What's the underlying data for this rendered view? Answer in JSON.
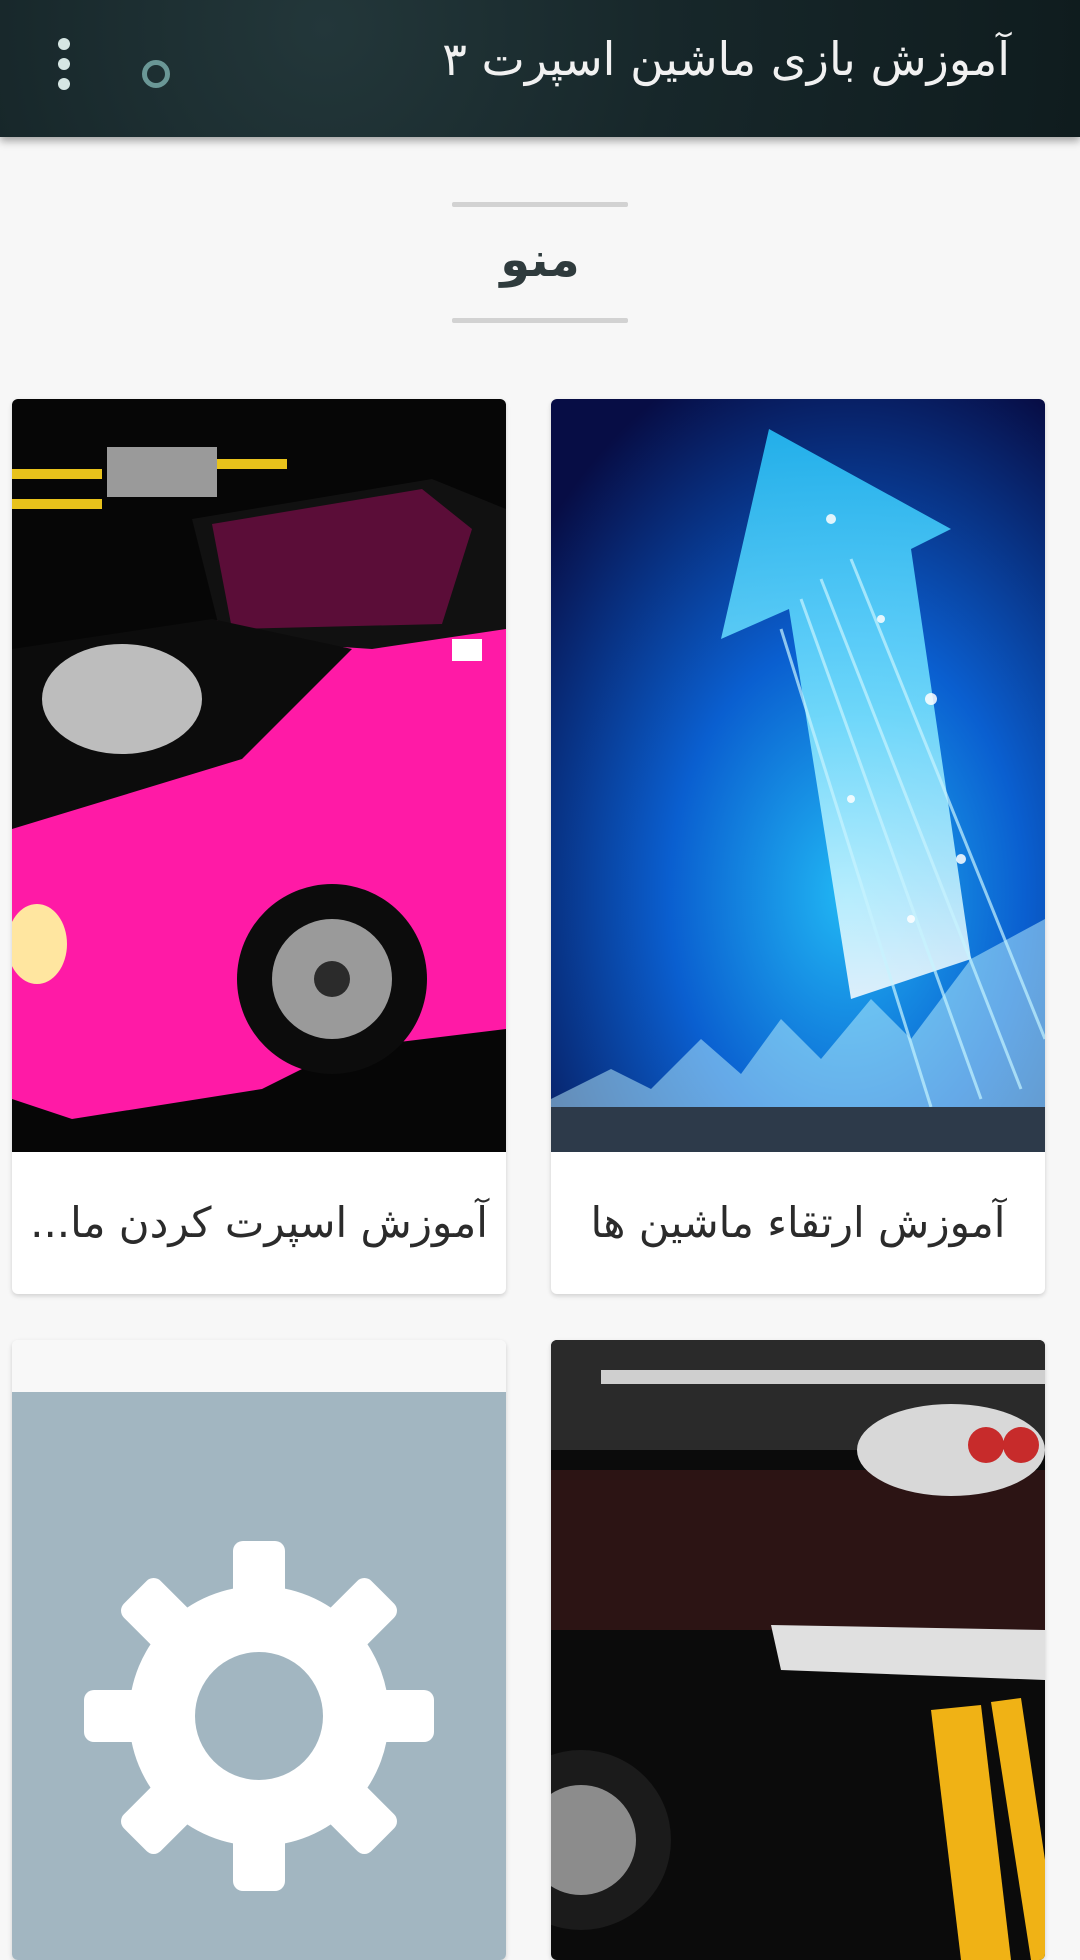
{
  "app_bar": {
    "title": "آموزش بازی ماشین اسپرت ۳",
    "menu_icon": "more-vert-icon",
    "circle_icon": "circle-outline-icon",
    "background_color": "#17272a"
  },
  "section": {
    "title": "منو"
  },
  "cards": [
    {
      "label": "آموزش ارتقاء ماشین ها",
      "image": "blue-upgrade-arrow-image"
    },
    {
      "label": "آموزش اسپرت کردن ما...",
      "image": "pink-sport-car-image"
    },
    {
      "label": "",
      "image": "black-muscle-car-image"
    },
    {
      "label": "",
      "image": "settings-gear-image"
    }
  ],
  "colors": {
    "accent_pink": "#ee1aa0",
    "gear_background": "#a2b6c1",
    "gear_foreground": "#ffffff"
  }
}
